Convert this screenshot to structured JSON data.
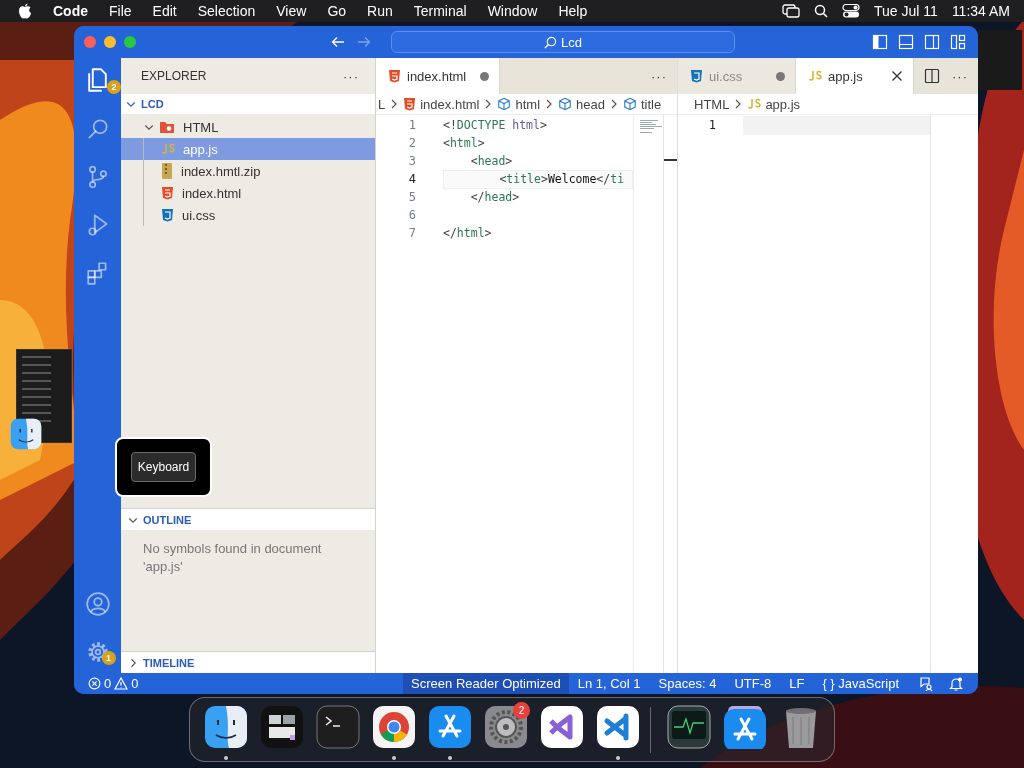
{
  "menu_bar": {
    "app_name": "Code",
    "menus": [
      "File",
      "Edit",
      "Selection",
      "View",
      "Go",
      "Run",
      "Terminal",
      "Window",
      "Help"
    ],
    "date": "Tue Jul 11",
    "time": "11:34 AM"
  },
  "command_center": {
    "text": "Lcd"
  },
  "activity_bar": [
    {
      "kind": "explorer",
      "selected": true,
      "badge": "2"
    },
    {
      "kind": "search",
      "selected": false
    },
    {
      "kind": "source_control",
      "selected": false
    },
    {
      "kind": "run",
      "selected": false
    },
    {
      "kind": "extensions",
      "selected": false
    }
  ],
  "activity_bar_bottom": [
    {
      "kind": "account"
    },
    {
      "kind": "settings",
      "badge": "1"
    }
  ],
  "sidebar": {
    "title": "EXPLORER",
    "more": "···",
    "tree": [
      {
        "label": "LCD",
        "kind": "root",
        "expanded": true,
        "children": [
          {
            "label": "HTML",
            "kind": "folder",
            "expanded": true,
            "children": [
              {
                "label": "app.js",
                "kind": "js",
                "selected": true
              },
              {
                "label": "index.hmtl.zip",
                "kind": "zip",
                "selected": false
              },
              {
                "label": "index.html",
                "kind": "html",
                "selected": false
              },
              {
                "label": "ui.css",
                "kind": "css",
                "selected": false
              }
            ]
          }
        ]
      }
    ],
    "sections": [
      {
        "title": "OUTLINE",
        "expanded": true,
        "message": "No symbols found in document 'app.js'"
      },
      {
        "title": "TIMELINE",
        "expanded": false
      }
    ]
  },
  "editor_groups": [
    {
      "tabs": [
        {
          "label": "index.html",
          "kind": "html",
          "selected": true,
          "dirty": true
        }
      ],
      "more": "···",
      "split_button": false,
      "minimap": true,
      "breadcrumbs": [
        {
          "text": "L",
          "kind": "plain"
        },
        {
          "text": "index.html",
          "kind": "html"
        },
        {
          "text": "html",
          "kind": "symbol"
        },
        {
          "text": "head",
          "kind": "symbol"
        },
        {
          "text": "title",
          "kind": "symbol"
        }
      ],
      "lines": [
        {
          "number": "1",
          "current": false,
          "tokens": [
            {
              "kind": "punct",
              "text": "<!"
            },
            {
              "kind": "doctype",
              "text": "DOCTYPE"
            },
            {
              "kind": "attr",
              "text": " html"
            },
            {
              "kind": "punct",
              "text": ">"
            }
          ]
        },
        {
          "number": "2",
          "current": false,
          "tokens": [
            {
              "kind": "punct",
              "text": "<"
            },
            {
              "kind": "tag",
              "text": "html"
            },
            {
              "kind": "punct",
              "text": ">"
            }
          ]
        },
        {
          "number": "3",
          "current": false,
          "tokens": [
            {
              "kind": "punct",
              "text": "    <"
            },
            {
              "kind": "tag",
              "text": "head"
            },
            {
              "kind": "punct",
              "text": ">"
            }
          ]
        },
        {
          "number": "4",
          "current": true,
          "tokens": [
            {
              "kind": "punct",
              "text": "        <"
            },
            {
              "kind": "tag",
              "text": "title"
            },
            {
              "kind": "punct",
              "text": ">"
            },
            {
              "kind": "text",
              "text": "Welcome"
            },
            {
              "kind": "punct",
              "text": "</"
            },
            {
              "kind": "tag",
              "text": "ti"
            }
          ]
        },
        {
          "number": "5",
          "current": false,
          "tokens": [
            {
              "kind": "punct",
              "text": "    </"
            },
            {
              "kind": "tag",
              "text": "head"
            },
            {
              "kind": "punct",
              "text": ">"
            }
          ]
        },
        {
          "number": "6",
          "current": false
        },
        {
          "number": "7",
          "current": false,
          "tokens": [
            {
              "kind": "punct",
              "text": "</"
            },
            {
              "kind": "tag",
              "text": "html"
            },
            {
              "kind": "punct",
              "text": ">"
            }
          ]
        }
      ]
    },
    {
      "tabs": [
        {
          "label": "ui.css",
          "kind": "css",
          "selected": false,
          "dirty": true
        },
        {
          "label": "app.js",
          "kind": "js",
          "selected": true,
          "dirty": false
        }
      ],
      "more": "···",
      "split_button": true,
      "minimap": false,
      "breadcrumbs": [
        {
          "text": "HTML",
          "kind": "plain"
        },
        {
          "text": "app.js",
          "kind": "js"
        }
      ],
      "lines": [
        {
          "number": "1",
          "current": true
        }
      ]
    }
  ],
  "status_bar": {
    "errors": "0",
    "warnings": "0",
    "items": [
      {
        "text": "Screen Reader Optimized",
        "highlighted": true
      },
      {
        "text": "Ln 1, Col 1",
        "highlighted": false
      },
      {
        "text": "Spaces: 4",
        "highlighted": false
      },
      {
        "text": "UTF-8",
        "highlighted": false
      },
      {
        "text": "LF",
        "highlighted": false
      },
      {
        "text": "{ } JavaScript",
        "highlighted": false
      }
    ]
  },
  "tooltip": {
    "text": "Keyboard"
  },
  "dock": {
    "apps": [
      {
        "kind": "finder",
        "running": true
      },
      {
        "kind": "windows",
        "running": false
      },
      {
        "kind": "terminal",
        "running": false
      },
      {
        "kind": "chrome",
        "running": true
      },
      {
        "kind": "appstore",
        "running": true
      },
      {
        "kind": "settings",
        "running": false,
        "badge": "2"
      },
      {
        "kind": "studio",
        "running": false
      },
      {
        "kind": "vscode",
        "running": true
      }
    ],
    "others": [
      {
        "kind": "monitor",
        "running": false
      },
      {
        "kind": "downloads",
        "running": false
      },
      {
        "kind": "trash",
        "running": false
      }
    ]
  }
}
